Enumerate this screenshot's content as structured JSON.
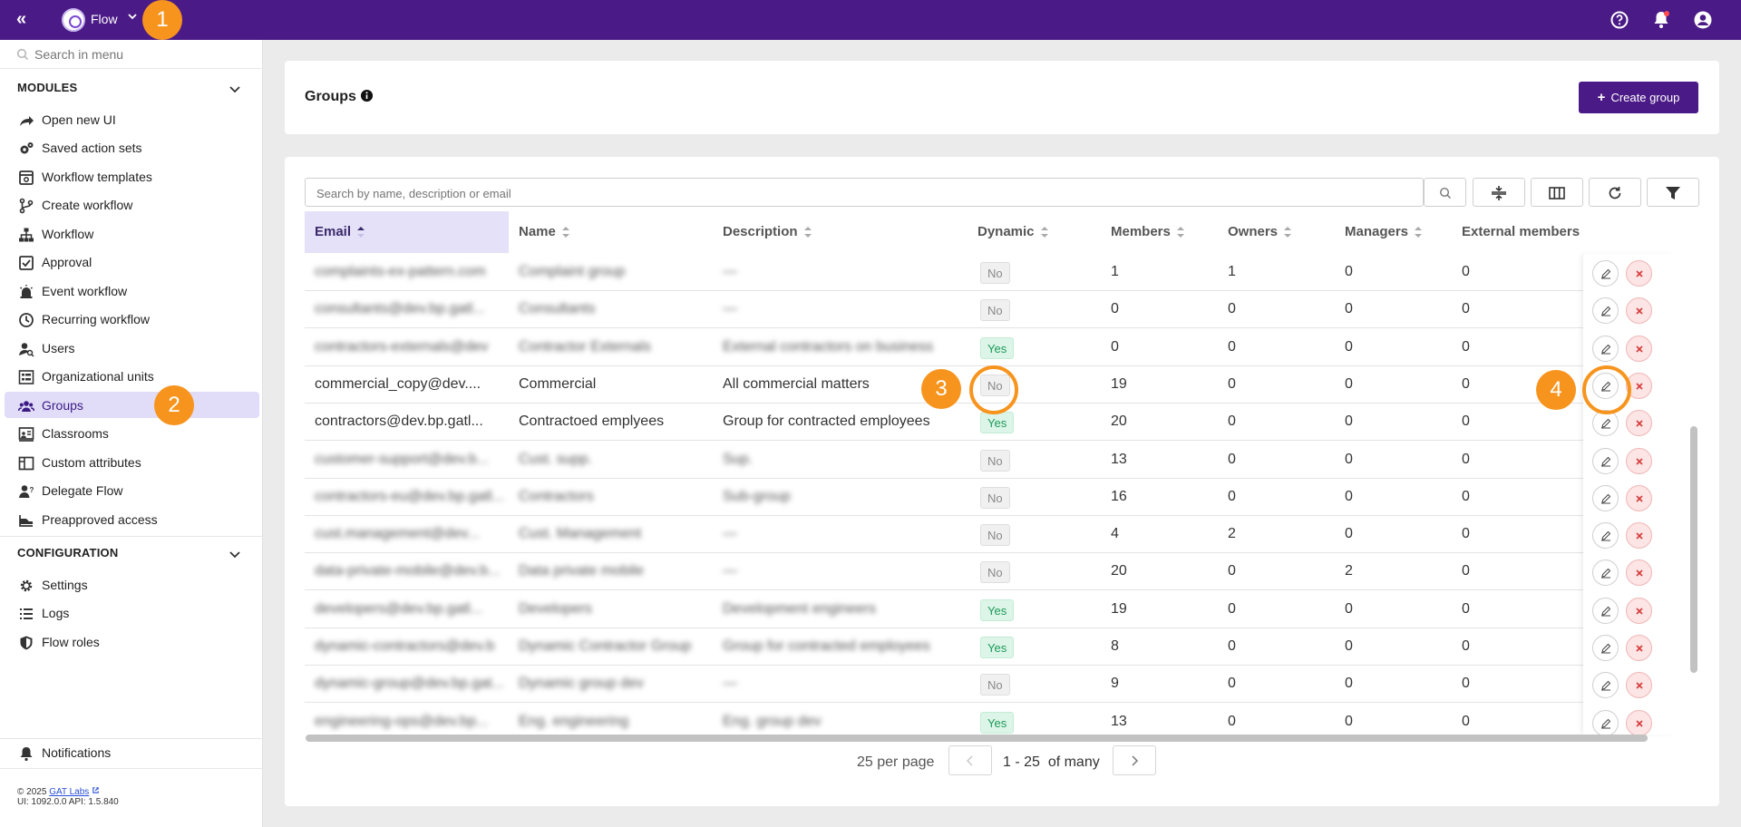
{
  "topbar": {
    "app_name": "Flow"
  },
  "sidebar": {
    "search_placeholder": "Search in menu",
    "modules_label": "MODULES",
    "modules": [
      {
        "label": "Open new UI",
        "icon": "share-arrow-icon"
      },
      {
        "label": "Saved action sets",
        "icon": "gears-icon"
      },
      {
        "label": "Workflow templates",
        "icon": "template-icon"
      },
      {
        "label": "Create workflow",
        "icon": "branch-icon"
      },
      {
        "label": "Workflow",
        "icon": "hierarchy-icon"
      },
      {
        "label": "Approval",
        "icon": "approval-icon"
      },
      {
        "label": "Event workflow",
        "icon": "alarm-icon"
      },
      {
        "label": "Recurring workflow",
        "icon": "clock-icon"
      },
      {
        "label": "Users",
        "icon": "users-search-icon"
      },
      {
        "label": "Organizational units",
        "icon": "org-units-icon"
      },
      {
        "label": "Groups",
        "icon": "groups-icon"
      },
      {
        "label": "Classrooms",
        "icon": "classroom-icon"
      },
      {
        "label": "Custom attributes",
        "icon": "custom-attributes-icon"
      },
      {
        "label": "Delegate Flow",
        "icon": "delegate-icon"
      },
      {
        "label": "Preapproved access",
        "icon": "preapproved-icon"
      }
    ],
    "config_label": "CONFIGURATION",
    "config": [
      {
        "label": "Settings",
        "icon": "gear-icon"
      },
      {
        "label": "Logs",
        "icon": "list-icon"
      },
      {
        "label": "Flow roles",
        "icon": "shield-icon"
      }
    ],
    "notifications_label": "Notifications",
    "footer_copyright": "© 2025",
    "footer_link": "GAT Labs",
    "footer_version": "UI: 1092.0.0 API: 1.5.840"
  },
  "header": {
    "title": "Groups",
    "create_label": "Create group"
  },
  "table": {
    "search_placeholder": "Search by name, description or email",
    "columns": [
      "Email",
      "Name",
      "Description",
      "Dynamic",
      "Members",
      "Owners",
      "Managers",
      "External members"
    ],
    "rows": [
      {
        "email": "complaints-ex-pattern.com",
        "name": "Complaint group",
        "description": "—",
        "dynamic": "No",
        "members": "1",
        "owners": "1",
        "managers": "0",
        "external": "0",
        "blurred": true
      },
      {
        "email": "consultants@dev.bp.gatl...",
        "name": "Consultants",
        "description": "—",
        "dynamic": "No",
        "members": "0",
        "owners": "0",
        "managers": "0",
        "external": "0",
        "blurred": true
      },
      {
        "email": "contractors-externals@dev",
        "name": "Contractor Externals",
        "description": "External contractors on business",
        "dynamic": "Yes",
        "members": "0",
        "owners": "0",
        "managers": "0",
        "external": "0",
        "blurred": true
      },
      {
        "email": "commercial_copy@dev....",
        "name": "Commercial",
        "description": "All commercial matters",
        "dynamic": "No",
        "members": "19",
        "owners": "0",
        "managers": "0",
        "external": "0",
        "blurred": false
      },
      {
        "email": "contractors@dev.bp.gatl...",
        "name": "Contractoed emplyees",
        "description": "Group for contracted employees",
        "dynamic": "Yes",
        "members": "20",
        "owners": "0",
        "managers": "0",
        "external": "0",
        "blurred": false
      },
      {
        "email": "customer-support@dev.b...",
        "name": "Cust. supp.",
        "description": "Sup.",
        "dynamic": "No",
        "members": "13",
        "owners": "0",
        "managers": "0",
        "external": "0",
        "blurred": true
      },
      {
        "email": "contractors-eu@dev.bp.gatl...",
        "name": "Contractors",
        "description": "Sub-group",
        "dynamic": "No",
        "members": "16",
        "owners": "0",
        "managers": "0",
        "external": "0",
        "blurred": true
      },
      {
        "email": "cust.management@dev...",
        "name": "Cust. Management",
        "description": "—",
        "dynamic": "No",
        "members": "4",
        "owners": "2",
        "managers": "0",
        "external": "0",
        "blurred": true
      },
      {
        "email": "data-private-mobile@dev.b...",
        "name": "Data private mobile",
        "description": "—",
        "dynamic": "No",
        "members": "20",
        "owners": "0",
        "managers": "2",
        "external": "0",
        "blurred": true
      },
      {
        "email": "developers@dev.bp.gatl...",
        "name": "Developers",
        "description": "Development engineers",
        "dynamic": "Yes",
        "members": "19",
        "owners": "0",
        "managers": "0",
        "external": "0",
        "blurred": true
      },
      {
        "email": "dynamic-contractors@dev.b",
        "name": "Dynamic Contractor Group",
        "description": "Group for contracted employees",
        "dynamic": "Yes",
        "members": "8",
        "owners": "0",
        "managers": "0",
        "external": "0",
        "blurred": true
      },
      {
        "email": "dynamic-group@dev.bp.gat...",
        "name": "Dynamic group dev",
        "description": "—",
        "dynamic": "No",
        "members": "9",
        "owners": "0",
        "managers": "0",
        "external": "0",
        "blurred": true
      },
      {
        "email": "engineering-ops@dev.bp...",
        "name": "Eng. engineering",
        "description": "Eng. group dev",
        "dynamic": "Yes",
        "members": "13",
        "owners": "0",
        "managers": "0",
        "external": "0",
        "blurred": true
      }
    ],
    "pagination": {
      "per_page": "25 per page",
      "range": "1 - 25",
      "of": "of many"
    }
  },
  "annotations": [
    "1",
    "2",
    "3",
    "4"
  ],
  "colors": {
    "topbar": "#4a1a86",
    "accent": "#4a1a86",
    "active_nav": "#e1dcf7",
    "marker": "#f7941d",
    "yes_badge": "#dcf5e8",
    "delete": "#fde5e5"
  }
}
